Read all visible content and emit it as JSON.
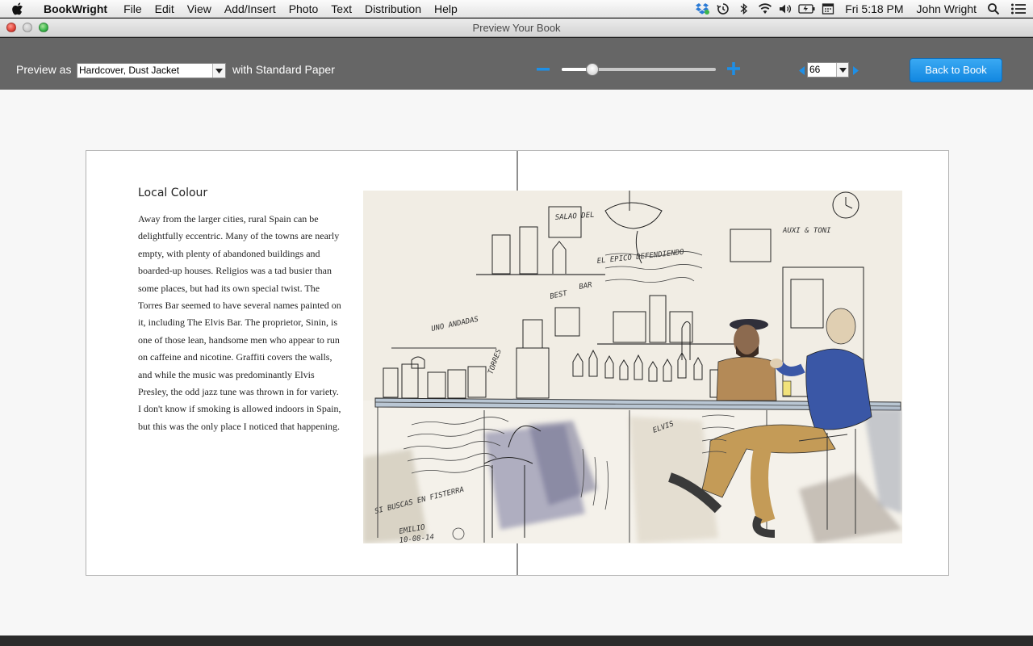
{
  "menubar": {
    "app_name": "BookWright",
    "items": [
      "File",
      "Edit",
      "View",
      "Add/Insert",
      "Photo",
      "Text",
      "Distribution",
      "Help"
    ],
    "clock": "Fri 5:18 PM",
    "user": "John Wright",
    "status_icons": [
      "dropbox-icon",
      "time-machine-icon",
      "bluetooth-icon",
      "wifi-icon",
      "volume-icon",
      "battery-icon",
      "calendar-icon",
      "spotlight-search-icon",
      "notification-center-icon"
    ]
  },
  "window": {
    "title": "Preview Your Book"
  },
  "toolbar": {
    "preview_label": "Preview as",
    "format_value": "Hardcover, Dust Jacket",
    "with_label": "with Standard Paper",
    "zoom_level": 0.2,
    "page_value": "66",
    "back_label": "Back to Book",
    "accent_color": "#1e8fe6"
  },
  "page": {
    "heading": "Local Colour",
    "body": "Away from the larger cities, rural Spain can be delightfully eccentric. Many of the towns are nearly empty, with plenty of abandoned buildings and boarded-up houses. Religios was a tad busier than some places, but had its own special twist. The Torres Bar seemed to have several names painted on it, including The Elvis Bar. The proprietor, Sinin, is one of those lean, handsome men who appear to run on caffeine and nicotine. Graffiti covers the walls, and while the music was predominantly Elvis Presley, the odd jazz tune was thrown in for variety. I don't know if smoking is allowed indoors in Spain, but this was the only place I noticed that happening.",
    "sketch": {
      "wall_texts": [
        "SALAO DEL",
        "BAR",
        "BEST",
        "AUXI & TONI",
        "EL EPICO DEFENDIENDO",
        "UNO ANDADAS",
        "SI BUSCAS EN FISTERRA",
        "EMILIO",
        "10-08-14",
        "TORRES",
        "ELVIS"
      ]
    }
  }
}
